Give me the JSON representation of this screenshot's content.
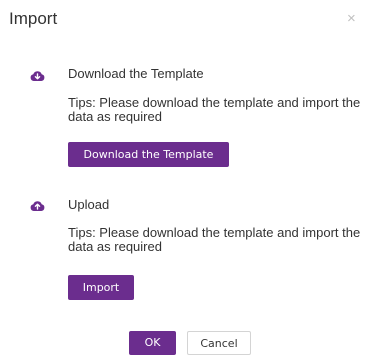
{
  "dialog": {
    "title": "Import",
    "close_glyph": "×",
    "accent_color": "#6b2d8e"
  },
  "steps": [
    {
      "icon": "cloud-download-icon",
      "title": "Download the Template",
      "tips": "Tips: Please download the template and import the data as required",
      "button_label": "Download the Template"
    },
    {
      "icon": "cloud-upload-icon",
      "title": "Upload",
      "tips": "Tips: Please download the template and import the data as required",
      "button_label": "Import"
    }
  ],
  "footer": {
    "ok_label": "OK",
    "cancel_label": "Cancel"
  }
}
